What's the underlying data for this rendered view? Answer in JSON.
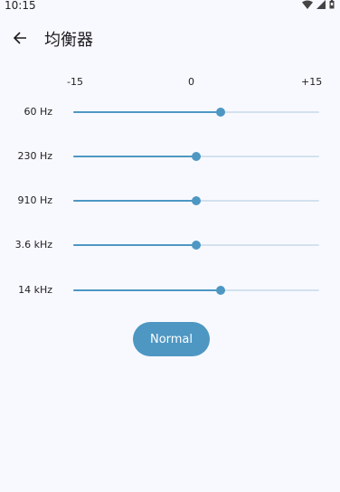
{
  "status_bar": {
    "time": "10:15",
    "icons": [
      "wifi-icon",
      "signal-icon",
      "battery-icon"
    ]
  },
  "app_bar": {
    "back_icon": "arrow-left-icon",
    "title": "均衡器"
  },
  "scale": {
    "min_label": "-15",
    "mid_label": "0",
    "max_label": "+15",
    "min": -15,
    "max": 15
  },
  "bands": [
    {
      "label": "60 Hz",
      "value": 3
    },
    {
      "label": "230 Hz",
      "value": 0
    },
    {
      "label": "910 Hz",
      "value": 0
    },
    {
      "label": "3.6 kHz",
      "value": 0
    },
    {
      "label": "14 kHz",
      "value": 3
    }
  ],
  "preset": {
    "label": "Normal"
  },
  "colors": {
    "accent": "#4e97c3",
    "track_inactive": "#d3e1ee",
    "background": "#f8f9ff"
  }
}
